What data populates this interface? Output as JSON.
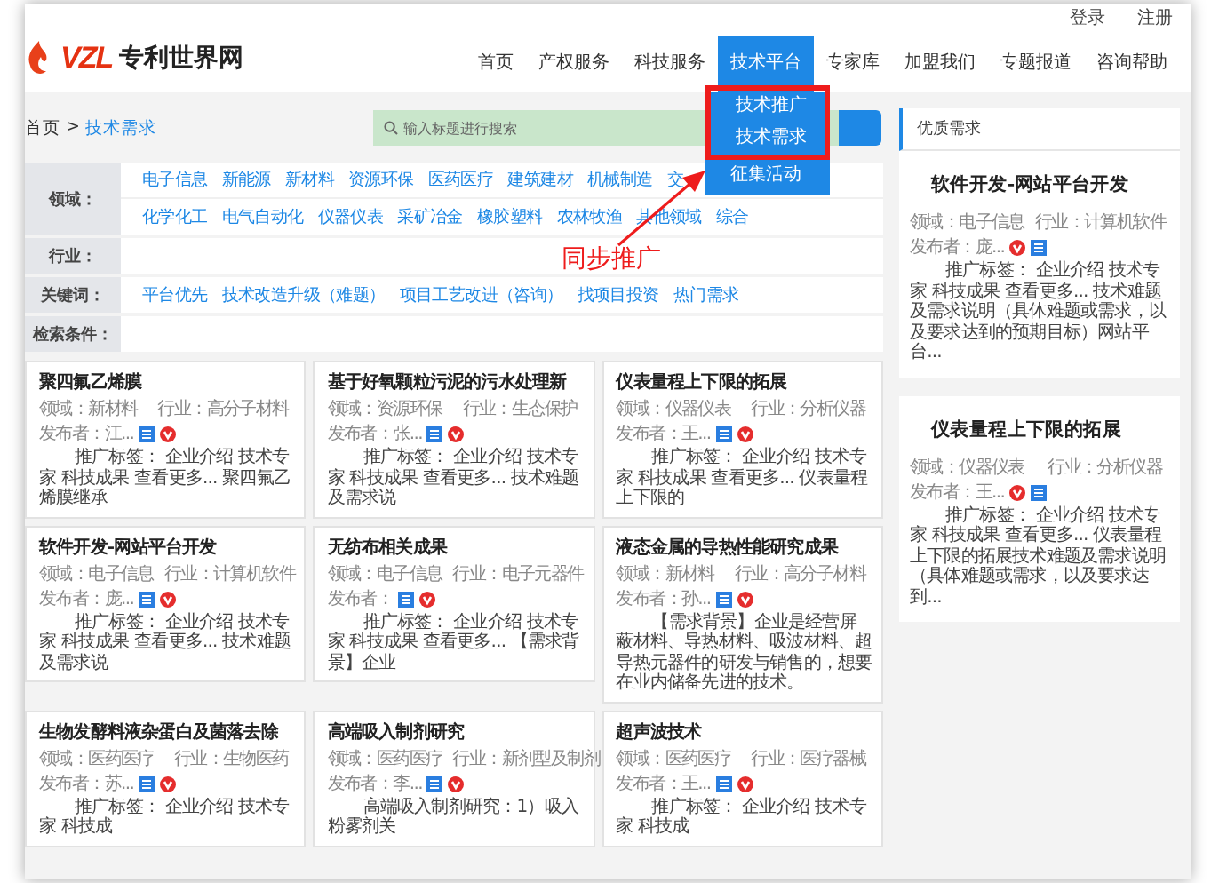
{
  "header": {
    "logo_letters": "VZL",
    "site_name": "专利世界网",
    "top_links": [
      "登录",
      "注册"
    ],
    "nav": [
      {
        "label": "首页",
        "selected": false
      },
      {
        "label": "产权服务",
        "selected": false
      },
      {
        "label": "科技服务",
        "selected": false
      },
      {
        "label": "技术平台",
        "selected": true
      },
      {
        "label": "专家库",
        "selected": false
      },
      {
        "label": "加盟我们",
        "selected": false
      },
      {
        "label": "专题报道",
        "selected": false
      },
      {
        "label": "咨询帮助",
        "selected": false
      }
    ],
    "dropdown": [
      {
        "label": "技术推广",
        "boxed": true
      },
      {
        "label": "技术需求",
        "boxed": true
      },
      {
        "label": "征集活动",
        "boxed": false
      }
    ]
  },
  "breadcrumb": {
    "home": "首页",
    "separator": ">",
    "current": "技术需求"
  },
  "search": {
    "placeholder": "输入标题进行搜索"
  },
  "filters": [
    {
      "label": "领域：",
      "lines": [
        [
          "电子信息",
          "新能源",
          "新材料",
          "资源环保",
          "医药医疗",
          "建筑建材",
          "机械制造",
          "交"
        ],
        [
          "化学化工",
          "电气自动化",
          "仪器仪表",
          "采矿冶金",
          "橡胶塑料",
          "农林牧渔",
          "其他领域",
          "综合"
        ]
      ]
    },
    {
      "label": "行业："
    },
    {
      "label": "关键词：",
      "lines": [
        [
          "平台优先",
          "技术改造升级（难题）",
          "项目工艺改进（咨询）",
          "找项目投资",
          "热门需求"
        ]
      ]
    },
    {
      "label": "检索条件："
    }
  ],
  "annotation": {
    "text": "同步推广"
  },
  "cards": [
    {
      "title": "聚四氟乙烯膜",
      "field": "领域：新材料",
      "industry": "行业：高分子材料",
      "publisher": "发布者：江...",
      "badges": [
        {
          "kind": "enterprise"
        },
        {
          "kind": "vip"
        }
      ],
      "description": "推广标签： 企业介绍 技术专家 科技成果 查看更多... 聚四氟乙烯膜继承"
    },
    {
      "title": "基于好氧颗粒污泥的污水处理新",
      "field": "领域：资源环保",
      "industry": "行业：生态保护",
      "publisher": "发布者：张...",
      "badges": [
        {
          "kind": "enterprise"
        },
        {
          "kind": "vip"
        }
      ],
      "description": "推广标签： 企业介绍 技术专家 科技成果 查看更多... 技术难题及需求说"
    },
    {
      "title": "仪表量程上下限的拓展",
      "field": "领域：仪器仪表",
      "industry": "行业：分析仪器",
      "publisher": "发布者：王...",
      "badges": [
        {
          "kind": "enterprise"
        },
        {
          "kind": "vip"
        }
      ],
      "description": "推广标签： 企业介绍 技术专家 科技成果 查看更多... 仪表量程上下限的"
    },
    {
      "title": "软件开发-网站平台开发",
      "field": "领域：电子信息",
      "industry": "行业：计算机软件",
      "publisher": "发布者：庞...",
      "badges": [
        {
          "kind": "enterprise"
        },
        {
          "kind": "vip"
        }
      ],
      "description": "推广标签： 企业介绍 技术专家 科技成果 查看更多... 技术难题及需求说"
    },
    {
      "title": "无纺布相关成果",
      "field": "领域：电子信息",
      "industry": "行业：电子元器件",
      "publisher": "发布者：",
      "badges": [
        {
          "kind": "enterprise"
        },
        {
          "kind": "vip"
        }
      ],
      "description": "推广标签： 企业介绍 技术专家 科技成果 查看更多... 【需求背景】企业"
    },
    {
      "title": "液态金属的导热性能研究成果",
      "field": "领域：新材料",
      "industry": "行业：高分子材料",
      "publisher": "发布者：孙...",
      "badges": [
        {
          "kind": "enterprise"
        },
        {
          "kind": "vip"
        }
      ],
      "description": "【需求背景】企业是经营屏蔽材料、导热材料、吸波材料、超导热元器件的研发与销售的，想要在业内储备先进的技术。"
    },
    {
      "title": "生物发酵料液杂蛋白及菌落去除",
      "field": "领域：医药医疗",
      "industry": "行业：生物医药",
      "publisher": "发布者：苏...",
      "badges": [
        {
          "kind": "enterprise"
        },
        {
          "kind": "vip"
        }
      ],
      "description": "推广标签： 企业介绍 技术专家 科技成"
    },
    {
      "title": "高端吸入制剂研究",
      "field": "领域：医药医疗",
      "industry": "行业：新剂型及制剂",
      "publisher": "发布者：李...",
      "badges": [
        {
          "kind": "enterprise"
        },
        {
          "kind": "vip"
        }
      ],
      "description": "高端吸入制剂研究：1）吸入粉雾剂关"
    },
    {
      "title": "超声波技术",
      "field": "领域：医药医疗",
      "industry": "行业：医疗器械",
      "publisher": "发布者：王...",
      "badges": [
        {
          "kind": "enterprise"
        },
        {
          "kind": "vip"
        }
      ],
      "description": "推广标签： 企业介绍 技术专家 科技成"
    }
  ],
  "sidebar": {
    "title": "优质需求",
    "cards": [
      {
        "title": "软件开发-网站平台开发",
        "field": "领域：电子信息",
        "industry": "行业：计算机软件",
        "publisher": "发布者：庞...",
        "badges": [
          {
            "kind": "vip"
          },
          {
            "kind": "enterprise"
          }
        ],
        "description": "推广标签： 企业介绍 技术专家 科技成果 查看更多... 技术难题及需求说明（具体难题或需求，以及要求达到的预期目标）网站平台..."
      },
      {
        "title": "仪表量程上下限的拓展",
        "field": "领域：仪器仪表",
        "industry": "行业：分析仪器",
        "publisher": "发布者：王...",
        "badges": [
          {
            "kind": "vip"
          },
          {
            "kind": "enterprise"
          }
        ],
        "description": "推广标签： 企业介绍 技术专家 科技成果 查看更多... 仪表量程上下限的拓展技术难题及需求说明（具体难题或需求，以及要求达到..."
      }
    ]
  }
}
